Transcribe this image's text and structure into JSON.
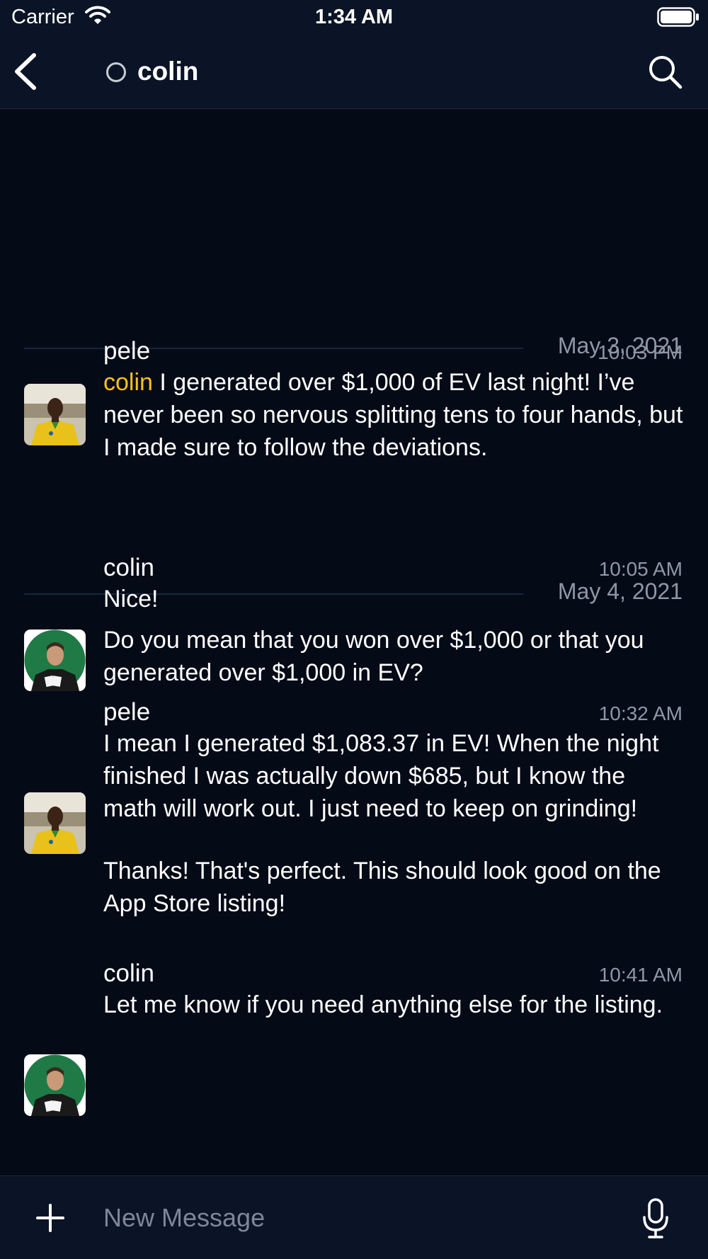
{
  "status_bar": {
    "carrier": "Carrier",
    "time": "1:34 AM",
    "icons": [
      "wifi-icon",
      "battery-icon"
    ]
  },
  "nav": {
    "back_icon": "chevron-left-icon",
    "presence_icon": "presence-circle-icon",
    "channel_name": "colin",
    "search_icon": "search-icon"
  },
  "colors": {
    "background": "#050a17",
    "bar_background": "#0b1426",
    "mention": "#f6c21c",
    "secondary_text": "#8f97a6"
  },
  "date_separators": [
    {
      "label": "May 3, 2021"
    },
    {
      "label": "May 4, 2021"
    }
  ],
  "messages": [
    {
      "user": "pele",
      "time": "10:03 PM",
      "mention": "colin",
      "text": " I generated over $1,000 of EV last night! I’ve never been so nervous splitting tens to four hands, but I made sure to follow the deviations."
    },
    {
      "user": "colin",
      "time": "10:05 AM",
      "text": "Nice!",
      "text2": "Do you mean that you won over $1,000 or that you generated over $1,000 in EV?"
    },
    {
      "user": "pele",
      "time": "10:32 AM",
      "text": "I mean I generated $1,083.37 in EV! When the night finished I was actually down $685, but I know the math will work out.  I just need to keep on grinding!",
      "text2": "Thanks! That's perfect.  This should look good on the App Store listing!"
    },
    {
      "user": "colin",
      "time": "10:41 AM",
      "text": "Let me know if you need anything else for the listing."
    }
  ],
  "composer": {
    "add_icon": "plus-icon",
    "placeholder": "New Message",
    "mic_icon": "microphone-icon"
  }
}
